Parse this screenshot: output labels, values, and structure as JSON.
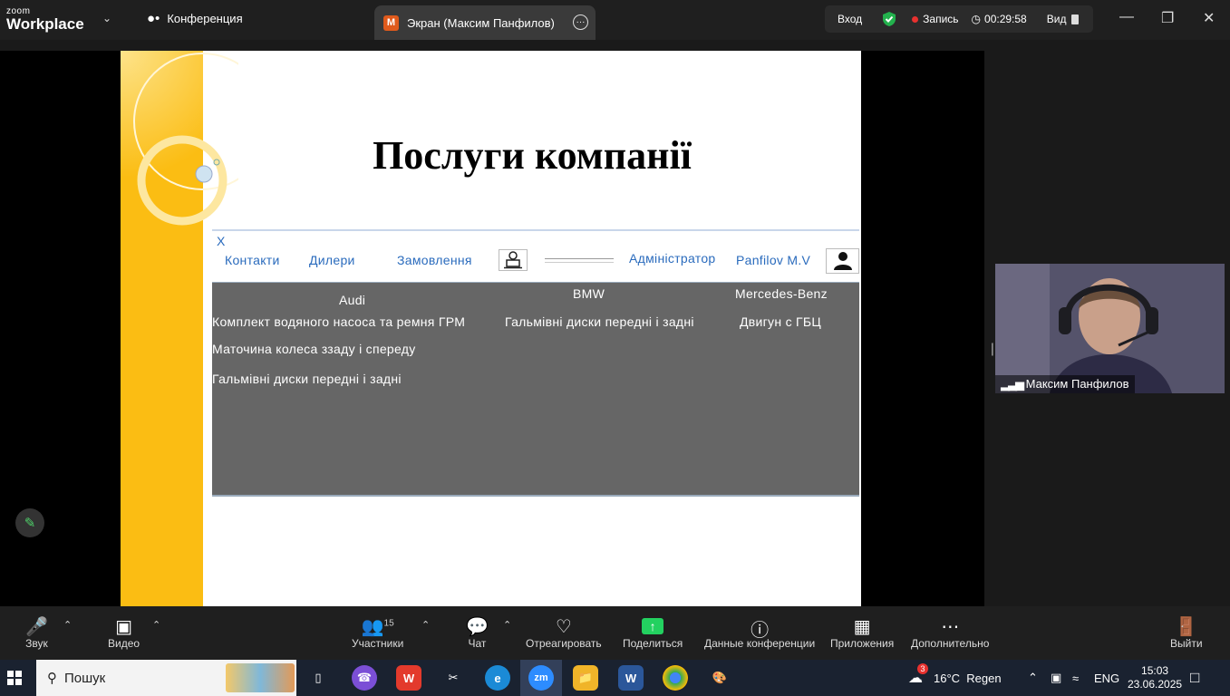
{
  "titlebar": {
    "logo_top": "zoom",
    "logo_bottom": "Workplace",
    "conference_tab": "Конференция",
    "screen_tab_initial": "М",
    "screen_tab": "Экран (Максим Панфилов)",
    "enter": "Вход",
    "record": "Запись",
    "timer": "00:29:58",
    "view": "Вид"
  },
  "slide": {
    "title": "Послуги компанії",
    "nav": {
      "close": "X",
      "contacts": "Контакти",
      "dealers": "Дилери",
      "orders": "Замовлення",
      "admin": "Адміністратор",
      "user": "Panfilov M.V"
    },
    "brands": [
      "Audi",
      "BMW",
      "Mercedes-Benz"
    ],
    "services": {
      "audi": [
        "Комплект водяного насоса та ремня ГРМ",
        "Маточина колеса ззаду і спереду",
        "Гальмівні диски передні і задні"
      ],
      "bmw": [
        "Гальмівні диски передні і задні"
      ],
      "mercedes": [
        "Двигун с ГБЦ"
      ]
    }
  },
  "video": {
    "name": "Максим Панфилов"
  },
  "toolbar": {
    "audio": "Звук",
    "video": "Видео",
    "participants": "Участники",
    "participants_count": "15",
    "chat": "Чат",
    "react": "Отреагировать",
    "share": "Поделиться",
    "info": "Данные конференции",
    "apps": "Приложения",
    "more": "Дополнительно",
    "leave": "Выйти"
  },
  "taskbar": {
    "search": "Пошук",
    "zoom_label": "zm",
    "word_label": "W",
    "weather_badge": "3",
    "weather": "16°C  Regen",
    "lang": "ENG",
    "time": "15:03",
    "date": "23.06.2025"
  },
  "colors": {
    "accent_link": "#2a6bbd",
    "slide_stripe": "#fbbd13",
    "record_dot": "#e8312f",
    "share_green": "#23d160"
  }
}
